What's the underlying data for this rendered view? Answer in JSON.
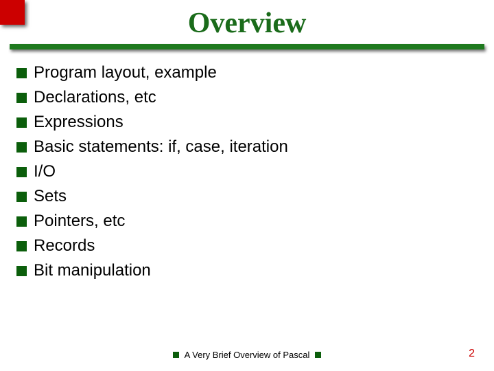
{
  "title": "Overview",
  "items": [
    "Program layout, example",
    "Declarations, etc",
    "Expressions",
    "Basic statements:  if, case, iteration",
    "I/O",
    "Sets",
    "Pointers, etc",
    "Records",
    "Bit manipulation"
  ],
  "footer": {
    "label": "A Very Brief Overview of Pascal",
    "page": "2"
  }
}
